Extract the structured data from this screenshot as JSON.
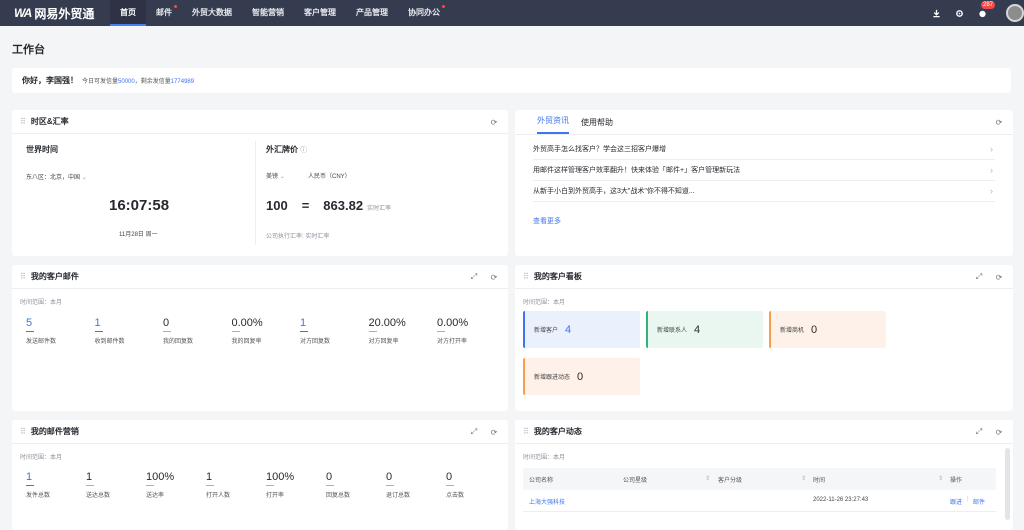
{
  "app": {
    "logo_mark": "WA",
    "name": "网易外贸通"
  },
  "nav": [
    {
      "label": "首页",
      "active": true,
      "dot": false
    },
    {
      "label": "邮件",
      "active": false,
      "dot": true
    },
    {
      "label": "外贸大数据",
      "active": false,
      "dot": false
    },
    {
      "label": "智能营销",
      "active": false,
      "dot": false
    },
    {
      "label": "客户管理",
      "active": false,
      "dot": false
    },
    {
      "label": "产品管理",
      "active": false,
      "dot": false
    },
    {
      "label": "协同办公",
      "active": false,
      "dot": true
    }
  ],
  "topright": {
    "badge": "287"
  },
  "page_title": "工作台",
  "greeting": {
    "hello": "你好，李国强！",
    "info_prefix": "今日可发信量",
    "today_quota": "50000",
    "sep": "，剩余发信量",
    "remaining": "1774989"
  },
  "timezone": {
    "title": "时区&汇率",
    "world_time": "世界时间",
    "zone": "东八区：北京，中国",
    "clock": "16:07:58",
    "date": "11月28日 周一",
    "fx_title": "外汇牌价",
    "from_ccy": "美镑",
    "to_ccy": "人民币（CNY）",
    "amount": "100",
    "eq": "=",
    "rate": "863.82",
    "rate_label": "实时汇率",
    "footnote": "公司执行汇率: 实时汇率"
  },
  "news": {
    "tabs": [
      "外贸资讯",
      "使用帮助"
    ],
    "items": [
      "外贸高手怎么找客户？学会这三招客户爆增",
      "用邮件这样管理客户效率翻升！快来体验「邮件+」客户管理新玩法",
      "从新手小白到外贸高手，这3大\"战术\"你不得不知道..."
    ],
    "more": "查看更多"
  },
  "customer_mail": {
    "title": "我的客户邮件",
    "range": "时间范围：本月",
    "stats": [
      {
        "value": "5",
        "label": "发送邮件数",
        "blue": true
      },
      {
        "value": "1",
        "label": "收到邮件数",
        "blue": true
      },
      {
        "value": "0",
        "label": "我的回复数",
        "blue": false
      },
      {
        "value": "0.00%",
        "label": "我的回复率",
        "blue": false
      },
      {
        "value": "1",
        "label": "对方回复数",
        "blue": true
      },
      {
        "value": "20.00%",
        "label": "对方回复率",
        "blue": false
      },
      {
        "value": "0.00%",
        "label": "对方打开率",
        "blue": false
      }
    ]
  },
  "board": {
    "title": "我的客户看板",
    "range": "时间范围：本月",
    "tiles": [
      {
        "label": "新增客户",
        "value": "4",
        "bg": "#eaf1fd",
        "edge": "#3f74f0",
        "blue": true
      },
      {
        "label": "新增联系人",
        "value": "4",
        "bg": "#eaf7f1",
        "edge": "#35b07a",
        "blue": false
      },
      {
        "label": "新增商机",
        "value": "0",
        "bg": "#fdf1ea",
        "edge": "#f3a04e",
        "blue": false
      },
      {
        "label": "新增跟进动态",
        "value": "0",
        "bg": "#fdf1ea",
        "edge": "#f3a04e",
        "blue": false
      }
    ]
  },
  "marketing": {
    "title": "我的邮件营销",
    "range": "时间范围：本月",
    "stats": [
      {
        "value": "1",
        "label": "发件总数",
        "blue": true
      },
      {
        "value": "1",
        "label": "送达总数",
        "blue": false
      },
      {
        "value": "100%",
        "label": "送达率",
        "blue": false
      },
      {
        "value": "1",
        "label": "打开人数",
        "blue": false
      },
      {
        "value": "100%",
        "label": "打开率",
        "blue": false
      },
      {
        "value": "0",
        "label": "回复总数",
        "blue": false
      },
      {
        "value": "0",
        "label": "退订总数",
        "blue": false
      },
      {
        "value": "0",
        "label": "点击数",
        "blue": false
      }
    ]
  },
  "activity": {
    "title": "我的客户动态",
    "range": "时间范围：本月",
    "columns": [
      "公司名称",
      "公司星级",
      "客户分级",
      "时间",
      "操作"
    ],
    "rows": [
      {
        "company": "上海大强科技",
        "star": "",
        "grade": "",
        "time": "2022-11-26 23:27:43",
        "ops": [
          "跟进",
          "邮件"
        ]
      }
    ]
  }
}
